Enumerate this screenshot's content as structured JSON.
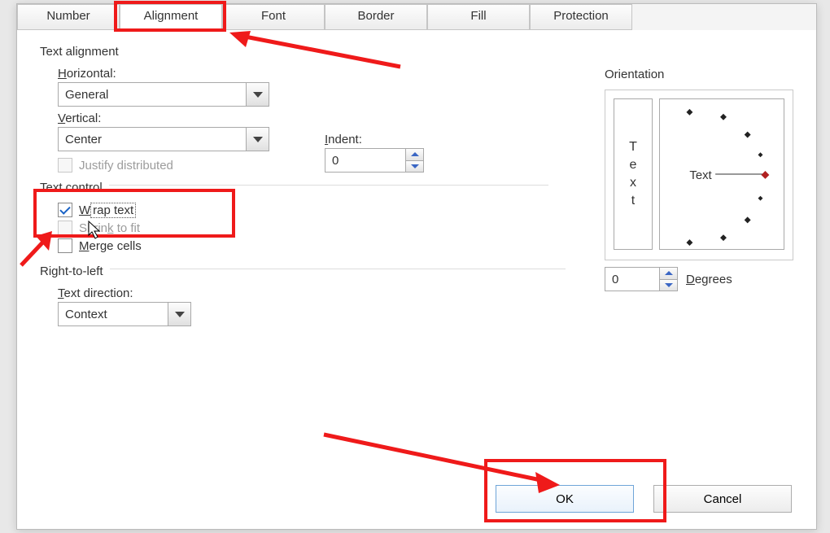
{
  "tabs": [
    "Number",
    "Alignment",
    "Font",
    "Border",
    "Fill",
    "Protection"
  ],
  "active_tab_index": 1,
  "text_alignment": {
    "title": "Text alignment",
    "horizontal_label": "Horizontal:",
    "horizontal_value": "General",
    "vertical_label": "Vertical:",
    "vertical_value": "Center",
    "indent_label": "Indent:",
    "indent_value": "0",
    "justify_distributed_label": "Justify distributed"
  },
  "text_control": {
    "title": "Text control",
    "wrap_text_label": "Wrap text",
    "wrap_text_checked": true,
    "shrink_to_fit_label": "Shrink to fit",
    "merge_cells_label": "Merge cells"
  },
  "rtl": {
    "title": "Right-to-left",
    "direction_label": "Text direction:",
    "direction_value": "Context"
  },
  "orientation": {
    "title": "Orientation",
    "vertical_letters": [
      "T",
      "e",
      "x",
      "t"
    ],
    "dial_label": "Text",
    "degrees_value": "0",
    "degrees_label": "Degrees"
  },
  "buttons": {
    "ok": "OK",
    "cancel": "Cancel"
  }
}
